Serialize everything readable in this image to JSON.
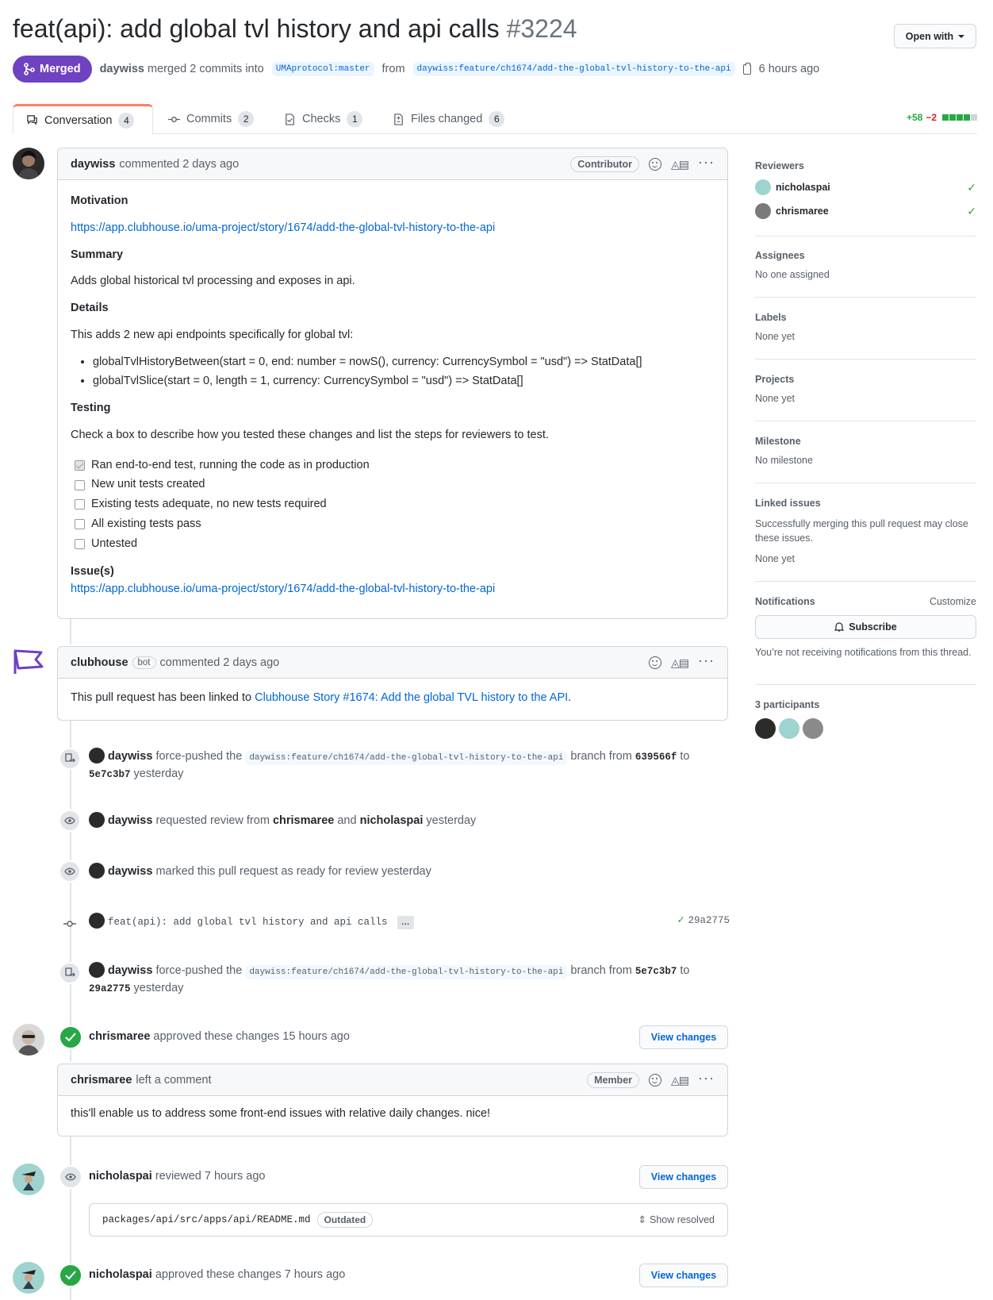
{
  "header": {
    "title": "feat(api): add global tvl history and api calls",
    "number": "#3224",
    "open_with": "Open with",
    "state": "Merged",
    "author": "daywiss",
    "merged_text": "merged 2 commits into",
    "base_branch": "UMAprotocol:master",
    "from_text": "from",
    "head_branch": "daywiss:feature/ch1674/add-the-global-tvl-history-to-the-api",
    "time": "6 hours ago"
  },
  "tabs": [
    {
      "label": "Conversation",
      "count": "4"
    },
    {
      "label": "Commits",
      "count": "2"
    },
    {
      "label": "Checks",
      "count": "1"
    },
    {
      "label": "Files changed",
      "count": "6"
    }
  ],
  "diffstat": {
    "additions": "+58",
    "deletions": "−2"
  },
  "description": {
    "author": "daywiss",
    "action": "commented 2 days ago",
    "role": "Contributor",
    "motivation_h": "Motivation",
    "motivation_link": "https://app.clubhouse.io/uma-project/story/1674/add-the-global-tvl-history-to-the-api",
    "summary_h": "Summary",
    "summary": "Adds global historical tvl processing and exposes in api.",
    "details_h": "Details",
    "details": "This adds 2 new api endpoints specifically for global tvl:",
    "endpoints": [
      "globalTvlHistoryBetween(start = 0, end: number = nowS(), currency: CurrencySymbol = \"usd\") => StatData[]",
      "globalTvlSlice(start = 0, length = 1, currency: CurrencySymbol = \"usd\") => StatData[]"
    ],
    "testing_h": "Testing",
    "testing": "Check a box to describe how you tested these changes and list the steps for reviewers to test.",
    "tasks": [
      "Ran end-to-end test, running the code as in production",
      "New unit tests created",
      "Existing tests adequate, no new tests required",
      "All existing tests pass",
      "Untested"
    ],
    "issues_h": "Issue(s)",
    "issues_link": "https://app.clubhouse.io/uma-project/story/1674/add-the-global-tvl-history-to-the-api"
  },
  "bot_comment": {
    "author": "clubhouse",
    "bot": "bot",
    "action": "commented 2 days ago",
    "text": "This pull request has been linked to",
    "link": "Clubhouse Story #1674: Add the global TVL history to the API",
    "period": "."
  },
  "events": {
    "push1": {
      "user": "daywiss",
      "verb": "force-pushed the",
      "branch": "daywiss:feature/ch1674/add-the-global-tvl-history-to-the-api",
      "from": "branch from",
      "sha_from": "639566f",
      "to": "to",
      "sha_to": "5e7c3b7",
      "time": "yesterday"
    },
    "review_req": {
      "user": "daywiss",
      "verb": "requested review from",
      "r1": "chrismaree",
      "and": "and",
      "r2": "nicholaspai",
      "time": "yesterday"
    },
    "ready": {
      "user": "daywiss",
      "verb": "marked this pull request as ready for review",
      "time": "yesterday"
    },
    "commit": {
      "message": "feat(api): add global tvl history and api calls",
      "ellipsis": "…",
      "sha": "29a2775"
    },
    "push2": {
      "user": "daywiss",
      "verb": "force-pushed the",
      "branch": "daywiss:feature/ch1674/add-the-global-tvl-history-to-the-api",
      "from": "branch from",
      "sha_from": "5e7c3b7",
      "to": "to",
      "sha_to": "29a2775",
      "time": "yesterday"
    },
    "approve1": {
      "user": "chrismaree",
      "verb": "approved these changes",
      "time": "15 hours ago",
      "button": "View changes"
    },
    "review_comment": {
      "author": "chrismaree",
      "action": "left a comment",
      "role": "Member",
      "text": "this'll enable us to address some front-end issues with relative daily changes. nice!"
    },
    "reviewed": {
      "user": "nicholaspai",
      "verb": "reviewed",
      "time": "7 hours ago",
      "button": "View changes",
      "file": "packages/api/src/apps/api/README.md",
      "outdated": "Outdated",
      "show_resolved": "Show resolved"
    },
    "approve2": {
      "user": "nicholaspai",
      "verb": "approved these changes",
      "time": "7 hours ago",
      "button": "View changes"
    }
  },
  "sidebar": {
    "reviewers_h": "Reviewers",
    "reviewers": [
      "nicholaspai",
      "chrismaree"
    ],
    "assignees_h": "Assignees",
    "assignees": "No one assigned",
    "labels_h": "Labels",
    "labels": "None yet",
    "projects_h": "Projects",
    "projects": "None yet",
    "milestone_h": "Milestone",
    "milestone": "No milestone",
    "linked_h": "Linked issues",
    "linked_desc": "Successfully merging this pull request may close these issues.",
    "linked": "None yet",
    "notifications_h": "Notifications",
    "customize": "Customize",
    "subscribe": "Subscribe",
    "notif_desc": "You’re not receiving notifications from this thread.",
    "participants_h": "3 participants"
  },
  "colors": {
    "merged": "#6f42c1",
    "link": "#0366d6",
    "success": "#28a745",
    "danger": "#cb2431"
  }
}
